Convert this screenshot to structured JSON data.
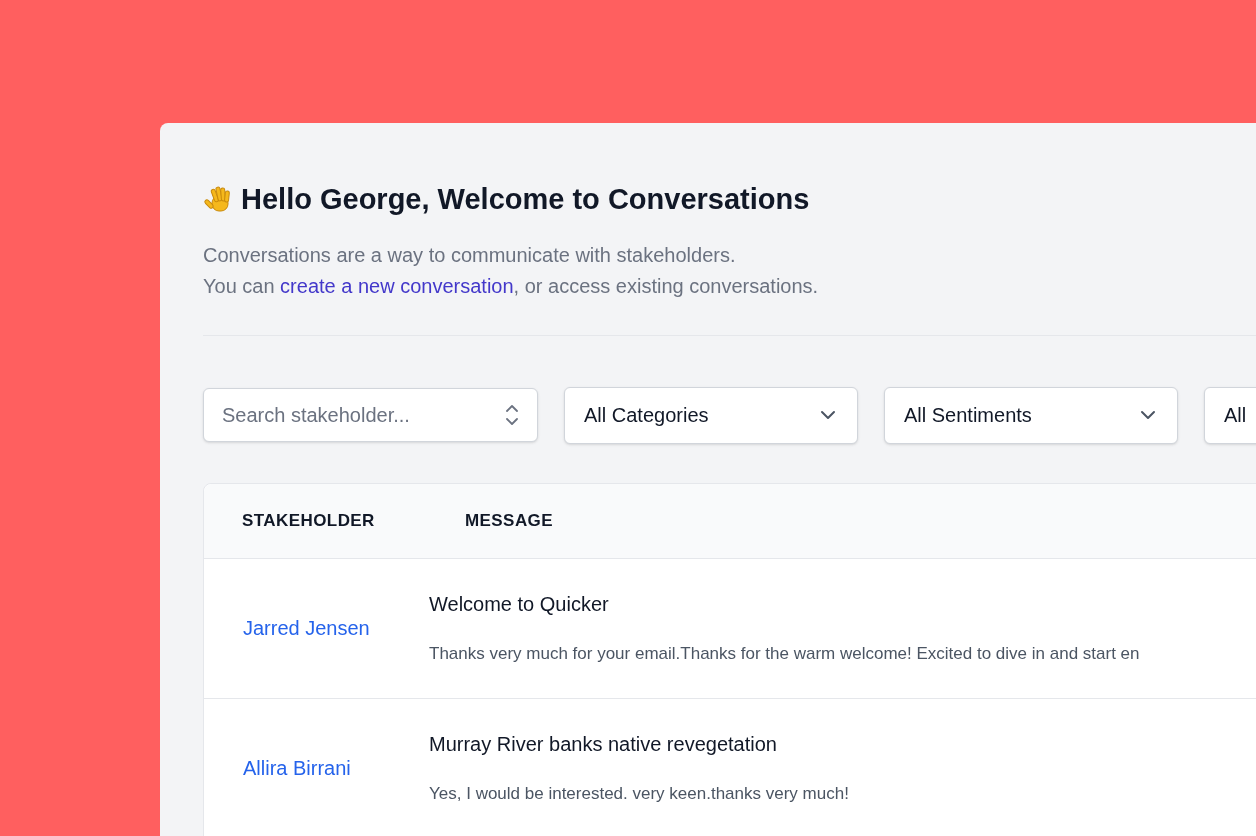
{
  "heading": {
    "title": "Hello George, Welcome to Conversations"
  },
  "intro": {
    "line_1": "Conversations are a way to communicate with stakeholders.",
    "prefix": "You can ",
    "link": "create a new conversation",
    "suffix": ", or access existing conversations."
  },
  "filters": [
    {
      "kind": "search",
      "placeholder": "Search stakeholder..."
    },
    {
      "kind": "select",
      "value": "All Categories"
    },
    {
      "kind": "select",
      "value": "All Sentiments"
    },
    {
      "kind": "select",
      "value": "All"
    }
  ],
  "table": {
    "columns": [
      "STAKEHOLDER",
      "MESSAGE"
    ],
    "rows": [
      {
        "stakeholder": "Jarred Jensen",
        "title": "Welcome to Quicker",
        "message": "Thanks very much for your email.Thanks for the warm welcome! Excited to dive in and start en"
      },
      {
        "stakeholder": "Allira Birrani",
        "title": "Murray River banks native revegetation",
        "message": "Yes, I would be interested. very keen.thanks very much!"
      }
    ]
  }
}
